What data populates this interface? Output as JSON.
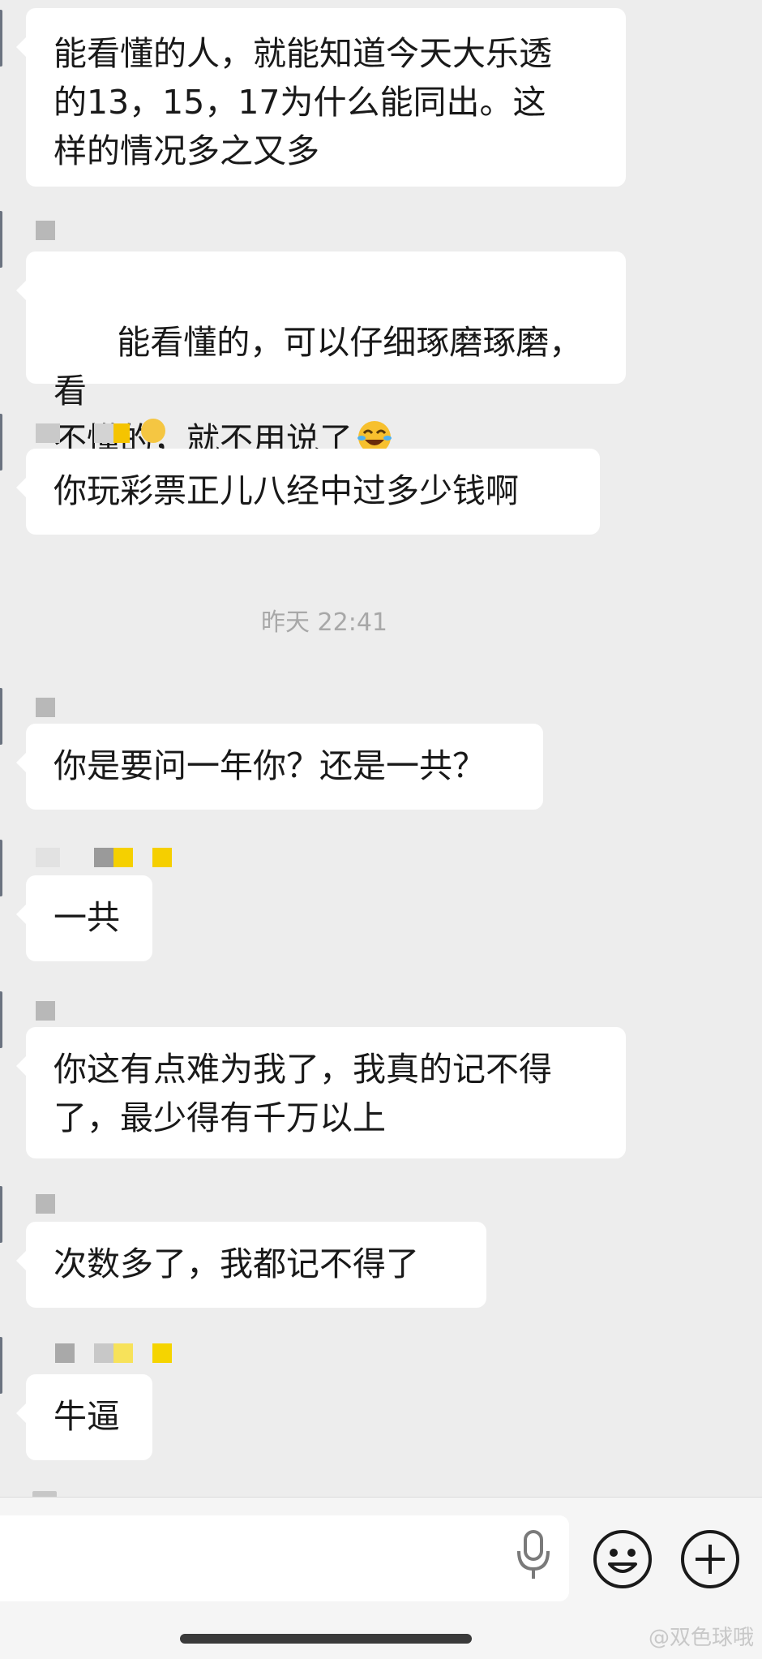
{
  "chat": {
    "timestamp": "昨天 22:41",
    "messages": [
      {
        "text": "能看懂的人，就能知道今天大乐透\n的13，15，17为什么能同出。这\n样的情况多之又多"
      },
      {
        "text": "能看懂的，可以仔细琢磨琢磨，看\n不懂的，就不用说了",
        "emoji": "face-with-tears-of-joy"
      },
      {
        "text": "你玩彩票正儿八经中过多少钱啊"
      },
      {
        "text": "你是要问一年你？还是一共？"
      },
      {
        "text": "一共"
      },
      {
        "text": "你这有点难为我了，我真的记不得\n了，最少得有千万以上"
      },
      {
        "text": "次数多了，我都记不得了"
      },
      {
        "text": "牛逼"
      }
    ]
  },
  "input_bar": {
    "placeholder": "",
    "icons": [
      "microphone-icon",
      "emoji-icon",
      "plus-icon"
    ]
  },
  "watermark": "@双色球哦"
}
